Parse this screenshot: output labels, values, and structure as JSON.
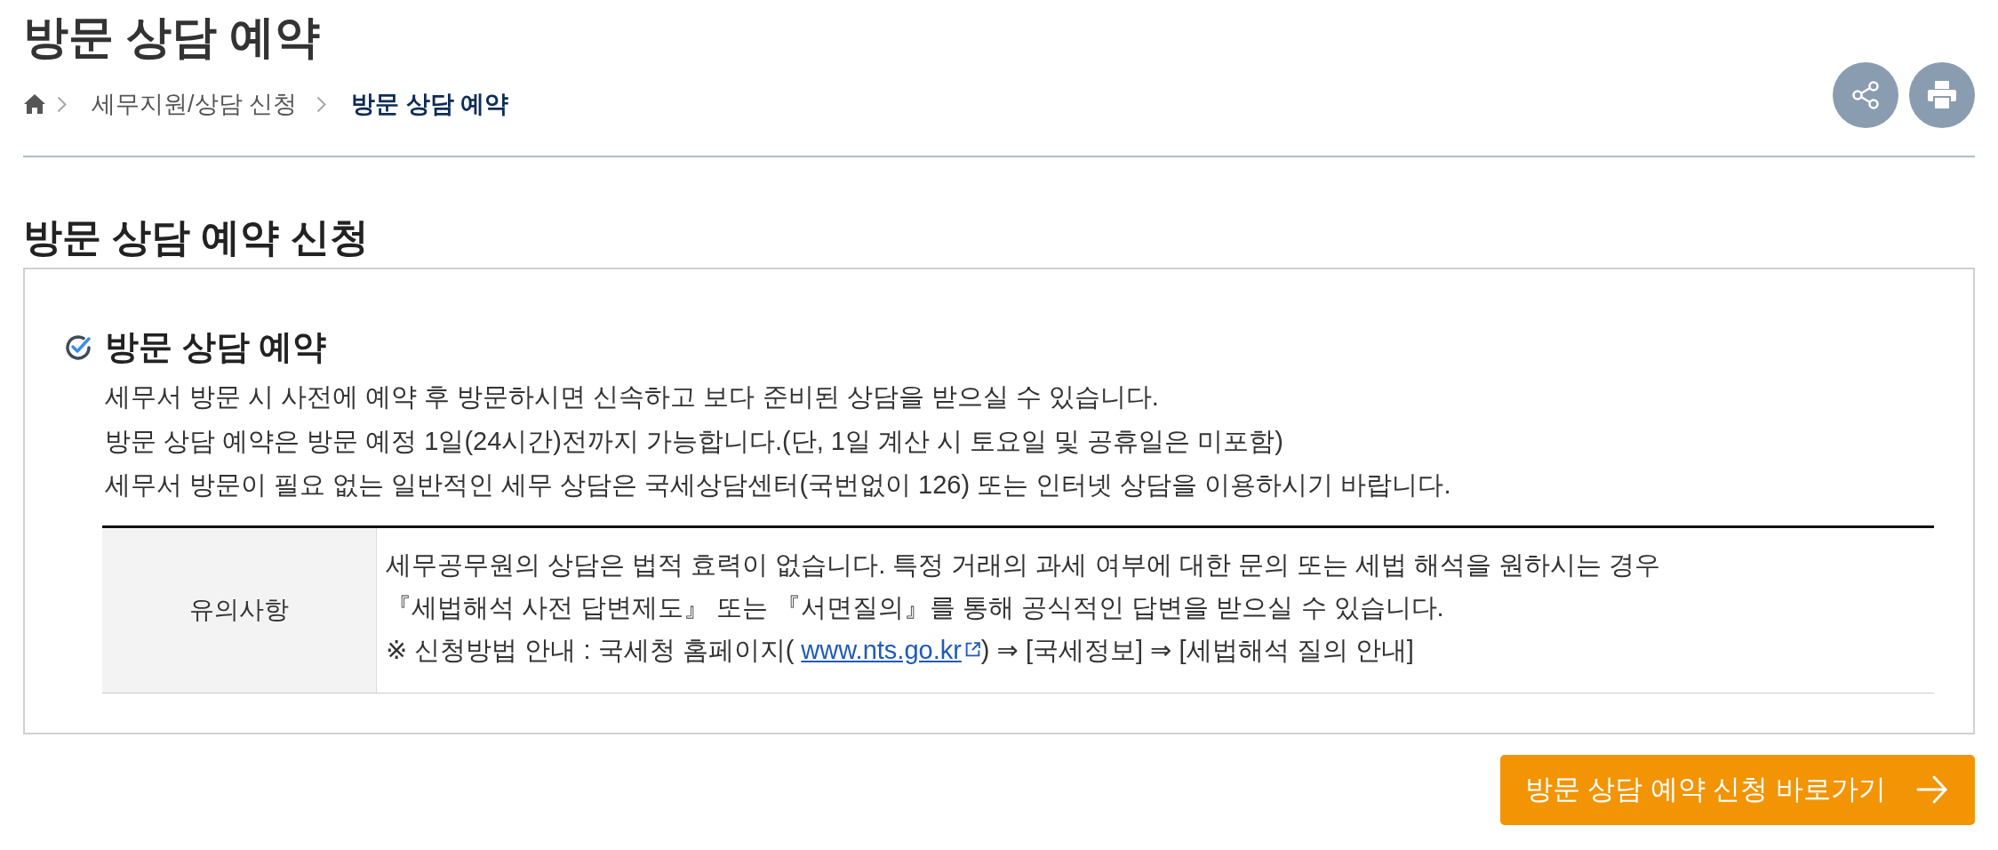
{
  "page_title": "방문 상담 예약",
  "breadcrumb": [
    {
      "label": "세무지원/상담 신청",
      "current": false
    },
    {
      "label": "방문 상담 예약",
      "current": true
    }
  ],
  "section_title": "방문 상담 예약 신청",
  "notice": {
    "title": "방문 상담 예약",
    "paragraphs": [
      "세무서 방문 시 사전에 예약 후 방문하시면 신속하고 보다 준비된 상담을 받으실 수 있습니다.",
      "방문 상담 예약은 방문 예정 1일(24시간)전까지 가능합니다.(단, 1일 계산 시 토요일 및 공휴일은 미포함)",
      "세무서 방문이 필요 없는 일반적인 세무 상담은 국세상담센터(국번없이 126) 또는 인터넷 상담을 이용하시기 바랍니다."
    ],
    "table": {
      "rows": [
        {
          "header": "유의사항",
          "lines": [
            {
              "kind": "plain",
              "text": "세무공무원의 상담은 법적 효력이 없습니다. 특정 거래의 과세 여부에 대한 문의 또는 세법 해석을 원하시는 경우"
            },
            {
              "kind": "plain",
              "text": "『세법해석 사전 답변제도』 또는 『서면질의』를 통해 공식적인 답변을 받으실 수 있습니다."
            },
            {
              "kind": "link",
              "before": "※ 신청방법 안내 : 국세청 홈페이지( ",
              "link": "www.nts.go.kr",
              "after": ") ⇒ [국세정보] ⇒ [세법해석 질의 안내]"
            }
          ]
        }
      ]
    }
  },
  "apply_button": {
    "label": "방문 상담 예약 신청 바로가기"
  }
}
